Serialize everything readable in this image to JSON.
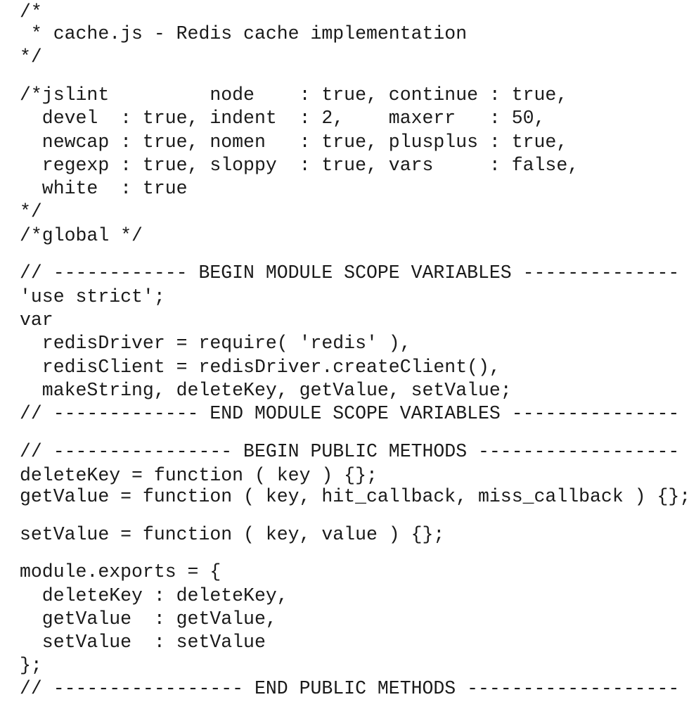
{
  "document": {
    "lines": [
      "/*",
      " * cache.js - Redis cache implementation",
      "*/",
      "/*jslint         node    : true, continue : true,",
      "  devel  : true, indent  : 2,    maxerr   : 50,",
      "  newcap : true, nomen   : true, plusplus : true,",
      "  regexp : true, sloppy  : true, vars     : false,",
      "  white  : true",
      "*/",
      "/*global */",
      "// ------------ BEGIN MODULE SCOPE VARIABLES --------------",
      "'use strict';",
      "var",
      "  redisDriver = require( 'redis' ),",
      "  redisClient = redisDriver.createClient(),",
      "  makeString, deleteKey, getValue, setValue;",
      "// ------------- END MODULE SCOPE VARIABLES ---------------",
      "// ---------------- BEGIN PUBLIC METHODS ------------------",
      "deleteKey = function ( key ) {};",
      "getValue = function ( key, hit_callback, miss_callback ) {};",
      "setValue = function ( key, value ) {};",
      "module.exports = {",
      "  deleteKey : deleteKey,",
      "  getValue  : getValue,",
      "  setValue  : setValue",
      "};",
      "// ----------------- END PUBLIC METHODS -------------------"
    ]
  }
}
